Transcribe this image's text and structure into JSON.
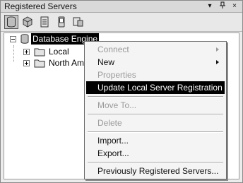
{
  "window": {
    "title": "Registered Servers",
    "controls": {
      "menu": "▾",
      "pin": "🖈",
      "close": "×"
    }
  },
  "toolbar": {
    "buttons": [
      {
        "icon": "database-engine-icon",
        "active": true
      },
      {
        "icon": "analysis-services-icon",
        "active": false
      },
      {
        "icon": "reporting-services-icon",
        "active": false
      },
      {
        "icon": "sql-mobile-icon",
        "active": false
      },
      {
        "icon": "integration-services-icon",
        "active": false
      }
    ]
  },
  "tree": {
    "root": {
      "label": "Database Engine",
      "expanded": true,
      "selected": true
    },
    "children": [
      {
        "label": "Local",
        "expanded": false
      },
      {
        "label": "North Ame",
        "expanded": false
      }
    ]
  },
  "context_menu": {
    "items": [
      {
        "label": "Connect",
        "disabled": true,
        "submenu": true
      },
      {
        "label": "New",
        "disabled": false,
        "submenu": true
      },
      {
        "label": "Properties",
        "disabled": true
      },
      {
        "label": "Update Local Server Registration",
        "disabled": false,
        "highlighted": true
      },
      {
        "label": "Move To...",
        "disabled": true
      },
      {
        "label": "Delete",
        "disabled": true
      },
      {
        "label": "Import...",
        "disabled": false
      },
      {
        "label": "Export...",
        "disabled": false
      },
      {
        "label": "Previously Registered Servers...",
        "disabled": false
      }
    ]
  }
}
